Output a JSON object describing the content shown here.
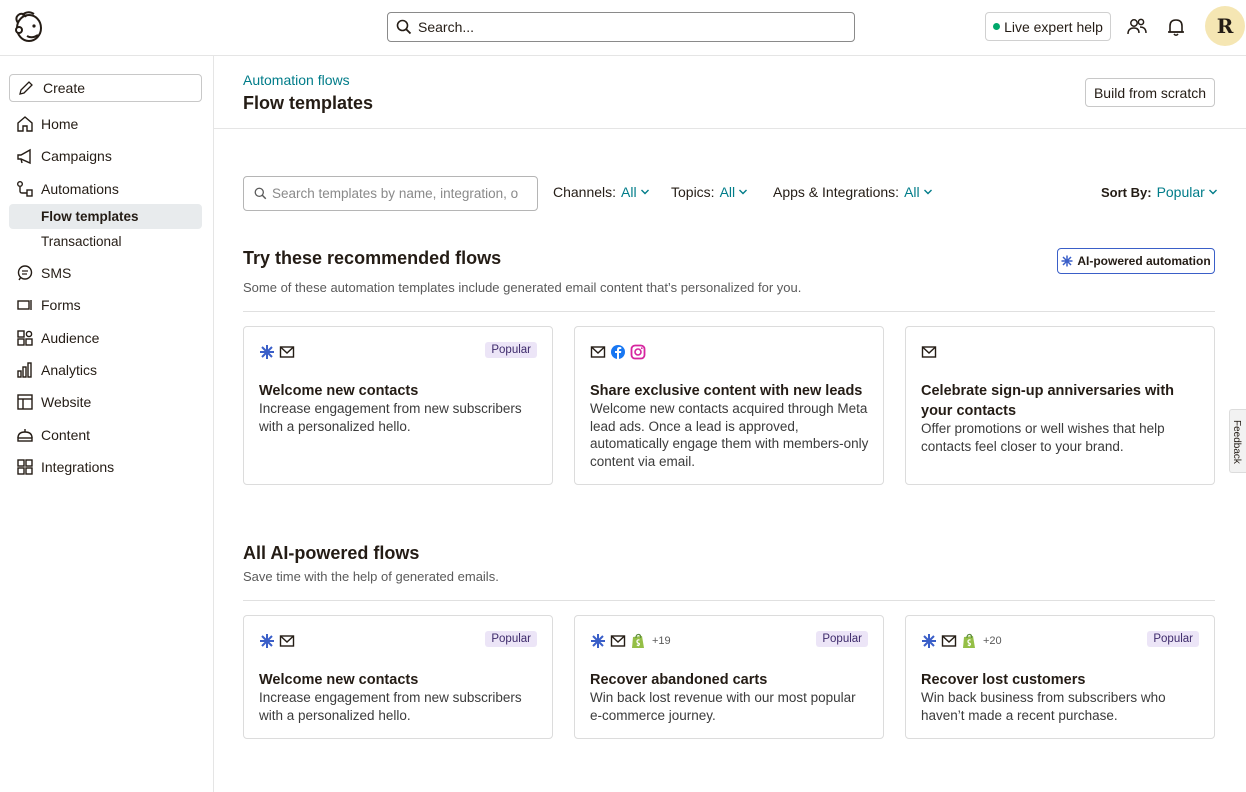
{
  "topbar": {
    "search_placeholder": "Search...",
    "live_help": "Live expert help",
    "avatar_initial": "R"
  },
  "sidebar": {
    "create": "Create",
    "items": [
      {
        "label": "Home",
        "icon": "home-icon"
      },
      {
        "label": "Campaigns",
        "icon": "megaphone-icon"
      },
      {
        "label": "Automations",
        "icon": "automations-icon"
      },
      {
        "label": "SMS",
        "icon": "sms-icon"
      },
      {
        "label": "Forms",
        "icon": "forms-icon"
      },
      {
        "label": "Audience",
        "icon": "audience-icon"
      },
      {
        "label": "Analytics",
        "icon": "analytics-icon"
      },
      {
        "label": "Website",
        "icon": "website-icon"
      },
      {
        "label": "Content",
        "icon": "content-icon"
      },
      {
        "label": "Integrations",
        "icon": "integrations-icon"
      }
    ],
    "sub_items": [
      {
        "label": "Flow templates",
        "active": true
      },
      {
        "label": "Transactional",
        "active": false
      }
    ]
  },
  "header": {
    "breadcrumb": "Automation flows",
    "title": "Flow templates",
    "build_button": "Build from scratch"
  },
  "filters": {
    "search_placeholder": "Search templates by name, integration, o",
    "channels_label": "Channels:",
    "channels_value": "All",
    "topics_label": "Topics:",
    "topics_value": "All",
    "apps_label": "Apps & Integrations:",
    "apps_value": "All",
    "sort_label": "Sort By:",
    "sort_value": "Popular"
  },
  "recommended": {
    "title": "Try these recommended flows",
    "subtitle": "Some of these automation templates include generated email content that’s personalized for you.",
    "ai_badge": "AI-powered automation",
    "cards": [
      {
        "icons": [
          "ai-sparkle-icon",
          "email-icon"
        ],
        "badge": "Popular",
        "title": "Welcome new contacts",
        "desc": "Increase engagement from new subscribers with a personalized hello."
      },
      {
        "icons": [
          "email-icon",
          "facebook-icon",
          "instagram-icon"
        ],
        "badge": "",
        "title": "Share exclusive content with new leads",
        "desc": "Welcome new contacts acquired through Meta lead ads. Once a lead is approved, automatically engage them with members-only content via email."
      },
      {
        "icons": [
          "email-icon"
        ],
        "badge": "",
        "title": "Celebrate sign-up anniversaries with your contacts",
        "desc": "Offer promotions or well wishes that help contacts feel closer to your brand."
      }
    ]
  },
  "ai_flows": {
    "title": "All AI-powered flows",
    "subtitle": "Save time with the help of generated emails.",
    "cards": [
      {
        "icons": [
          "ai-sparkle-icon",
          "email-icon"
        ],
        "more": "",
        "badge": "Popular",
        "title": "Welcome new contacts",
        "desc": "Increase engagement from new subscribers with a personalized hello."
      },
      {
        "icons": [
          "ai-sparkle-icon",
          "email-icon",
          "shopify-icon"
        ],
        "more": "+19",
        "badge": "Popular",
        "title": "Recover abandoned carts",
        "desc": "Win back lost revenue with our most popular e-commerce journey."
      },
      {
        "icons": [
          "ai-sparkle-icon",
          "email-icon",
          "shopify-icon"
        ],
        "more": "+20",
        "badge": "Popular",
        "title": "Recover lost customers",
        "desc": "Win back business from subscribers who haven’t made a recent purchase."
      }
    ]
  },
  "feedback": "Feedback",
  "colors": {
    "accent": "#007c89",
    "ai_border": "#3a5fc8",
    "badge_bg": "#ece5f7",
    "active_nav": "#e8ebed"
  }
}
